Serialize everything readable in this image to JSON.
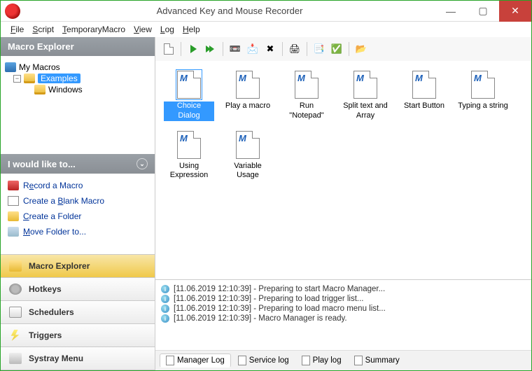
{
  "window": {
    "title": "Advanced Key and Mouse Recorder"
  },
  "menu": [
    "File",
    "Script",
    "TemporaryMacro",
    "View",
    "Log",
    "Help"
  ],
  "sidebar": {
    "header": "Macro Explorer",
    "tree": {
      "root": "My Macros",
      "folder_sel": "Examples",
      "sub": "Windows"
    },
    "actions_header": "I would like to...",
    "actions": {
      "record": "Record a Macro",
      "blank": "Create a Blank Macro",
      "folder": "Create a Folder",
      "move": "Move Folder to..."
    },
    "nav": {
      "explorer": "Macro Explorer",
      "hotkeys": "Hotkeys",
      "schedulers": "Schedulers",
      "triggers": "Triggers",
      "systray": "Systray Menu"
    }
  },
  "files": [
    {
      "label": "Choice Dialog",
      "selected": true
    },
    {
      "label": "Play a macro"
    },
    {
      "label": "Run \"Notepad\""
    },
    {
      "label": "Split text and Array"
    },
    {
      "label": "Start Button"
    },
    {
      "label": "Typing a string"
    },
    {
      "label": "Using Expression"
    },
    {
      "label": "Variable Usage"
    }
  ],
  "log": {
    "lines": [
      "[11.06.2019 12:10:39] - Preparing to start Macro Manager...",
      "[11.06.2019 12:10:39] -     Preparing to load trigger list...",
      "[11.06.2019 12:10:39] -     Preparing to load macro menu list...",
      "[11.06.2019 12:10:39] - Macro Manager is ready."
    ],
    "tabs": {
      "manager": "Manager Log",
      "service": "Service log",
      "play": "Play log",
      "summary": "Summary"
    }
  }
}
